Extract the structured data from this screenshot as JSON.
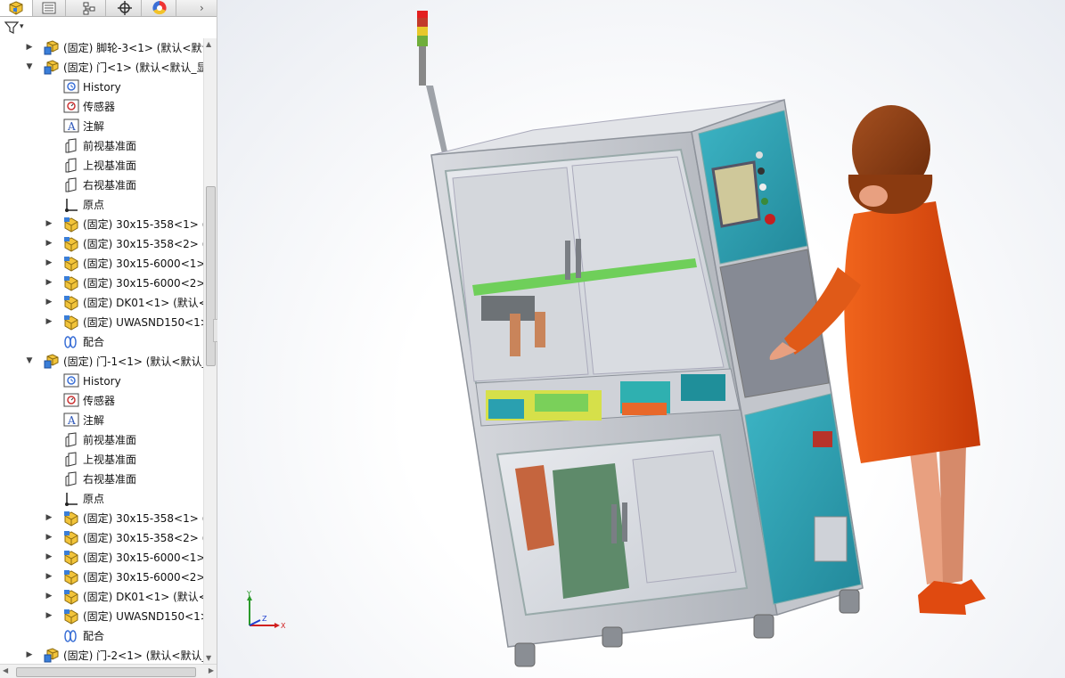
{
  "tabs": [
    {
      "name": "feature-manager",
      "icon": "feature-manager-icon"
    },
    {
      "name": "property-manager",
      "icon": "property-manager-icon"
    },
    {
      "name": "configuration-manager",
      "icon": "configuration-manager-icon"
    },
    {
      "name": "dimxpert-manager",
      "icon": "dimxpert-icon"
    },
    {
      "name": "display-manager",
      "icon": "display-manager-icon"
    }
  ],
  "filter": {
    "icon": "filter-icon",
    "dropdown": "▾"
  },
  "tree": [
    {
      "level": 1,
      "expand": "collapsed",
      "type": "assembly",
      "label": "(固定) 脚轮-3<1> (默认<默认"
    },
    {
      "level": 1,
      "expand": "expanded",
      "type": "assembly",
      "label": "(固定) 门<1> (默认<默认_显"
    },
    {
      "level": 2,
      "expand": "none",
      "type": "history",
      "label": "History"
    },
    {
      "level": 2,
      "expand": "none",
      "type": "sensor",
      "label": "传感器"
    },
    {
      "level": 2,
      "expand": "none",
      "type": "annotation",
      "label": "注解"
    },
    {
      "level": 2,
      "expand": "none",
      "type": "plane",
      "label": "前视基准面"
    },
    {
      "level": 2,
      "expand": "none",
      "type": "plane",
      "label": "上视基准面"
    },
    {
      "level": 2,
      "expand": "none",
      "type": "plane",
      "label": "右视基准面"
    },
    {
      "level": 2,
      "expand": "none",
      "type": "origin",
      "label": "原点"
    },
    {
      "level": 2,
      "expand": "collapsed",
      "type": "part",
      "label": "(固定) 30x15-358<1> (默"
    },
    {
      "level": 2,
      "expand": "collapsed",
      "type": "part",
      "label": "(固定) 30x15-358<2> (默"
    },
    {
      "level": 2,
      "expand": "collapsed",
      "type": "part",
      "label": "(固定) 30x15-6000<1>"
    },
    {
      "level": 2,
      "expand": "collapsed",
      "type": "part",
      "label": "(固定) 30x15-6000<2>"
    },
    {
      "level": 2,
      "expand": "collapsed",
      "type": "part",
      "label": "(固定) DK01<1> (默认<"
    },
    {
      "level": 2,
      "expand": "collapsed",
      "type": "part",
      "label": "(固定) UWASND150<1>"
    },
    {
      "level": 2,
      "expand": "none",
      "type": "mate",
      "label": "配合"
    },
    {
      "level": 1,
      "expand": "expanded",
      "type": "assembly",
      "label": "(固定) 门-1<1> (默认<默认_"
    },
    {
      "level": 2,
      "expand": "none",
      "type": "history",
      "label": "History"
    },
    {
      "level": 2,
      "expand": "none",
      "type": "sensor",
      "label": "传感器"
    },
    {
      "level": 2,
      "expand": "none",
      "type": "annotation",
      "label": "注解"
    },
    {
      "level": 2,
      "expand": "none",
      "type": "plane",
      "label": "前视基准面"
    },
    {
      "level": 2,
      "expand": "none",
      "type": "plane",
      "label": "上视基准面"
    },
    {
      "level": 2,
      "expand": "none",
      "type": "plane",
      "label": "右视基准面"
    },
    {
      "level": 2,
      "expand": "none",
      "type": "origin",
      "label": "原点"
    },
    {
      "level": 2,
      "expand": "collapsed",
      "type": "part",
      "label": "(固定) 30x15-358<1> (默"
    },
    {
      "level": 2,
      "expand": "collapsed",
      "type": "part",
      "label": "(固定) 30x15-358<2> (默"
    },
    {
      "level": 2,
      "expand": "collapsed",
      "type": "part",
      "label": "(固定) 30x15-6000<1>"
    },
    {
      "level": 2,
      "expand": "collapsed",
      "type": "part",
      "label": "(固定) 30x15-6000<2>"
    },
    {
      "level": 2,
      "expand": "collapsed",
      "type": "part",
      "label": "(固定) DK01<1> (默认<"
    },
    {
      "level": 2,
      "expand": "collapsed",
      "type": "part",
      "label": "(固定) UWASND150<1>"
    },
    {
      "level": 2,
      "expand": "none",
      "type": "mate",
      "label": "配合"
    },
    {
      "level": 1,
      "expand": "collapsed",
      "type": "assembly",
      "label": "(固定) 门-2<1> (默认<默认_"
    }
  ],
  "triad": {
    "y": "Y",
    "x": "X",
    "z": "Z"
  },
  "colors": {
    "frame": "#c9ccd1",
    "panel_teal": "#2f9fb0",
    "coat": "#e04a10",
    "hair": "#8a3a10",
    "skin": "#e8a080"
  }
}
